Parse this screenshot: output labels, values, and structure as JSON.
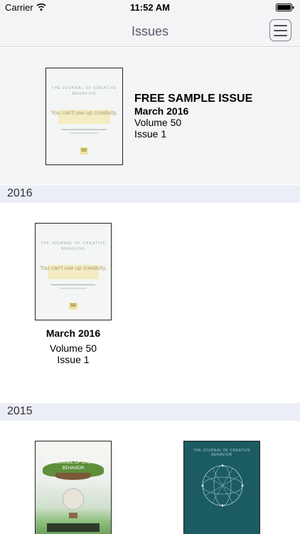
{
  "status_bar": {
    "carrier": "Carrier",
    "time": "11:52 AM"
  },
  "nav": {
    "title": "Issues"
  },
  "featured": {
    "label": "FREE SAMPLE ISSUE",
    "date": "March 2016",
    "volume": "Volume 50",
    "issue": "Issue 1",
    "cover": {
      "journal": "THE JOURNAL OF CREATIVE BEHAVIOR",
      "tagline": "You can't use up creativity.",
      "logo": "50"
    }
  },
  "sections": [
    {
      "year": "2016",
      "issues": [
        {
          "date": "March 2016",
          "volume": "Volume 50",
          "issue": "Issue 1",
          "cover": {
            "journal": "THE JOURNAL OF CREATIVE BEHAVIOR",
            "tagline": "You can't use up creativity.",
            "logo": "50"
          }
        }
      ]
    },
    {
      "year": "2015",
      "issues": [
        {
          "cover": {
            "journal": "THE JOURNAL OF CREATIVE BEHAVIOR"
          }
        },
        {
          "cover": {
            "journal": "THE JOURNAL OF CREATIVE BEHAVIOR"
          }
        }
      ]
    }
  ],
  "colors": {
    "bar_background": "#f4f4f6",
    "section_header": "#eceef7",
    "title_text": "#555b6a",
    "teal_cover": "#1b5b62"
  }
}
